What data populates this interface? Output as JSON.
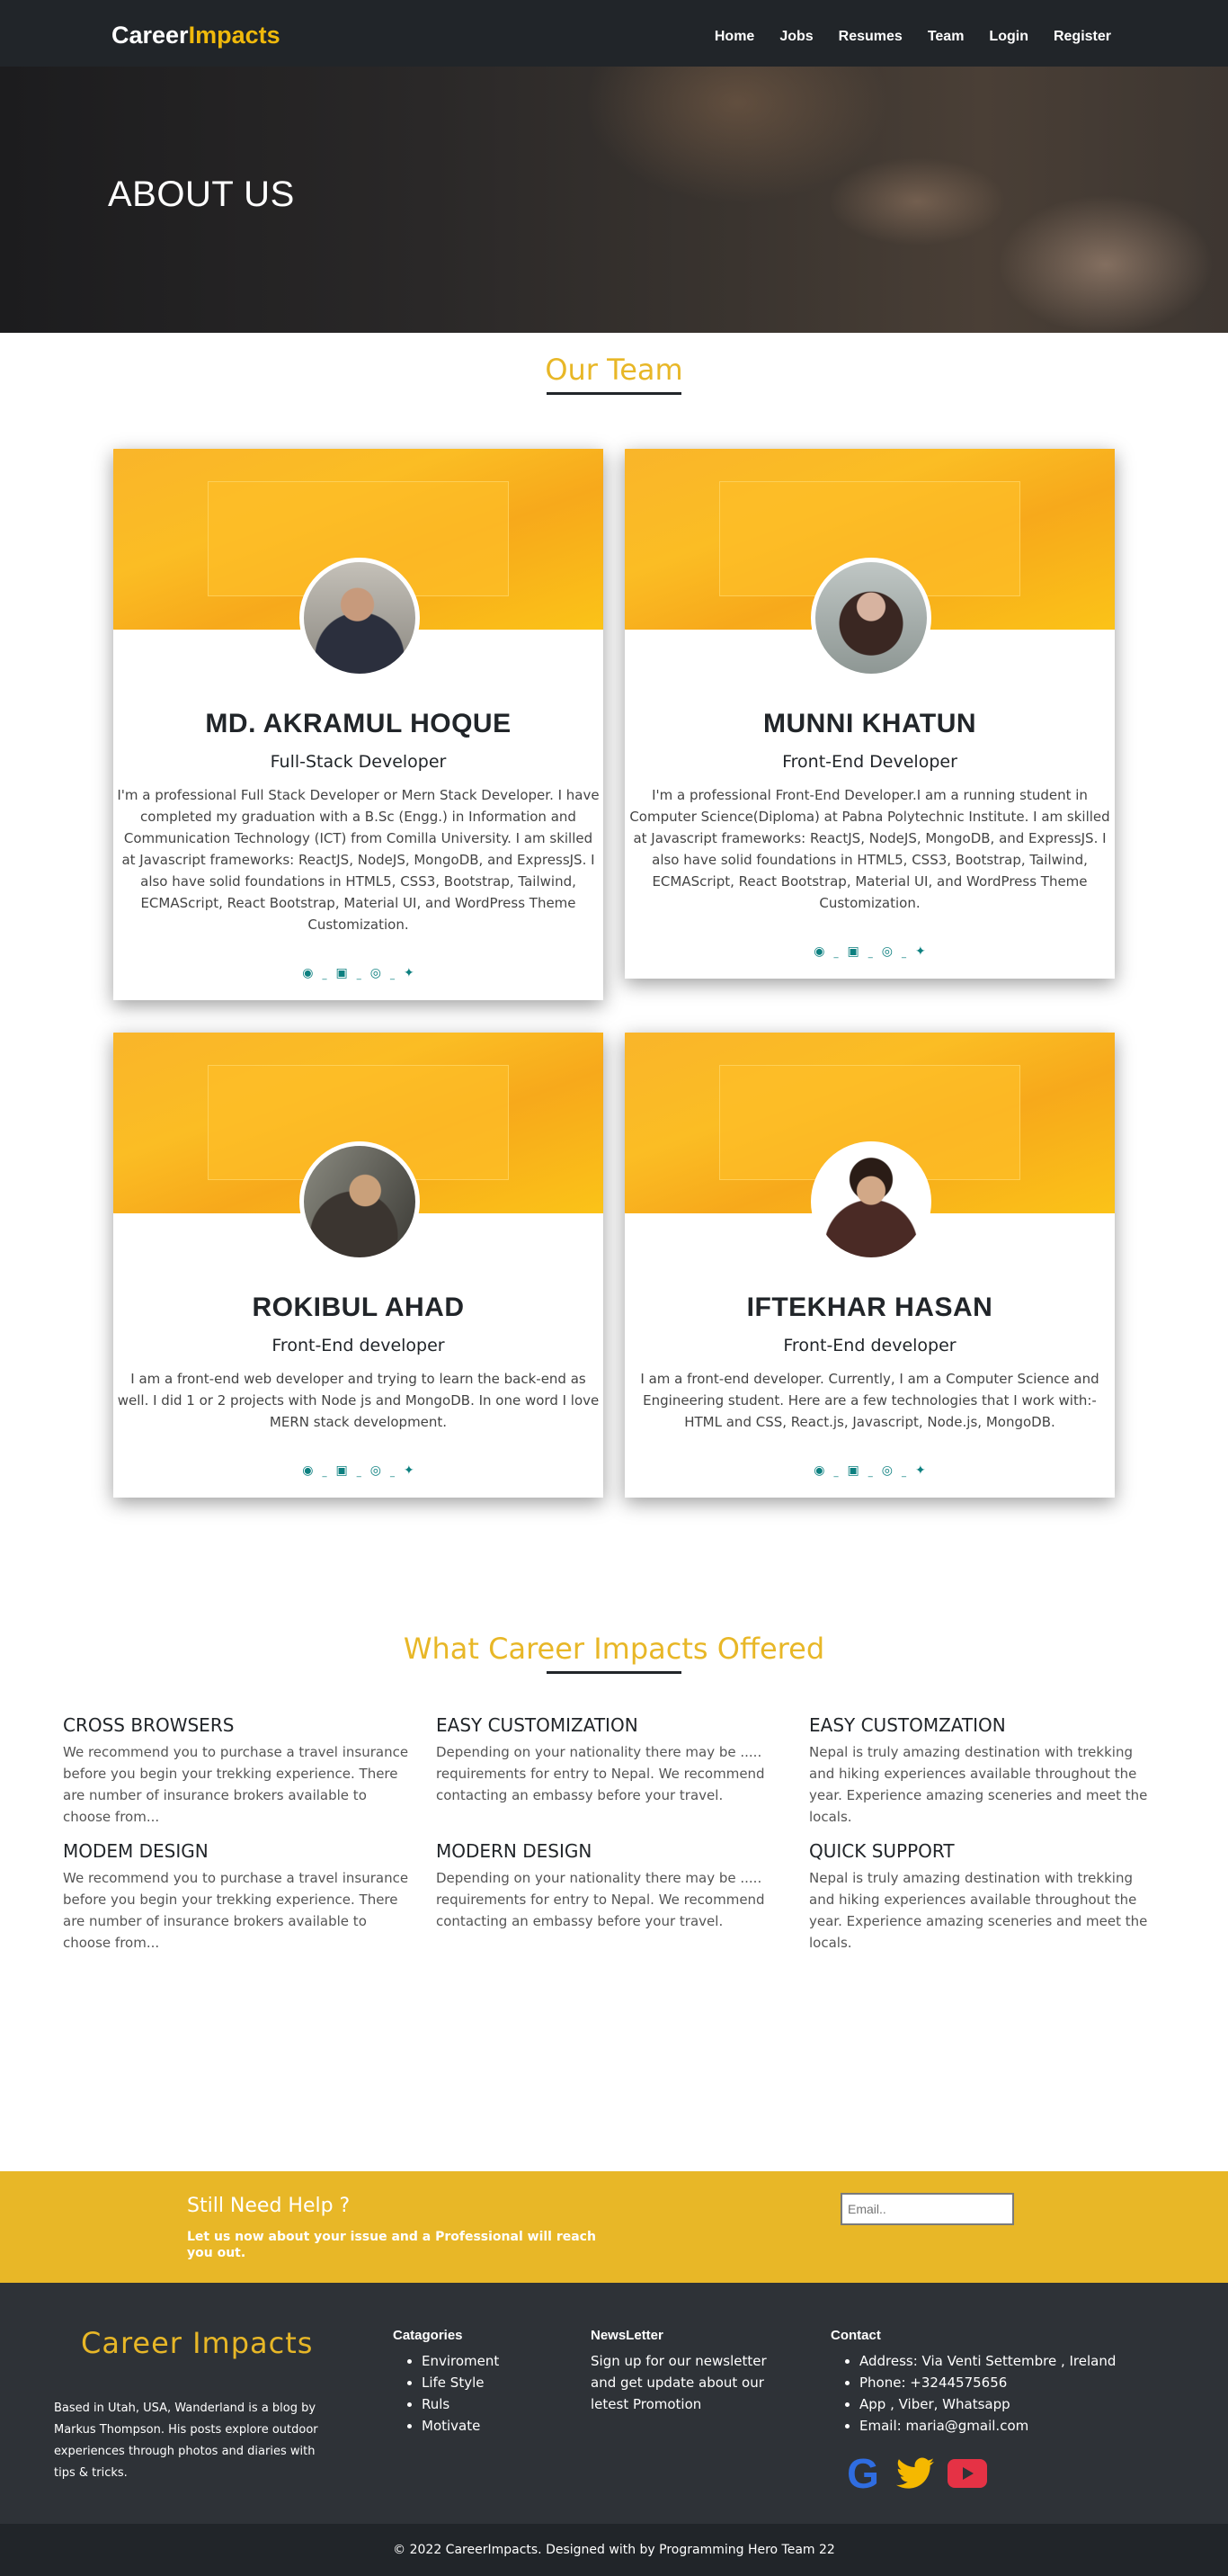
{
  "nav": {
    "brand_part1": "Career",
    "brand_part2": "Impacts",
    "links": [
      "Home",
      "Jobs",
      "Resumes",
      "Team",
      "Login",
      "Register"
    ]
  },
  "hero": {
    "title": "ABOUT US"
  },
  "team": {
    "heading": "Our Team",
    "members": [
      {
        "name": "MD. AKRAMUL HOQUE",
        "role": "Full-Stack Developer",
        "bio": "I'm a professional Full Stack Developer or Mern Stack Developer. I have completed my graduation with a B.Sc (Engg.) in Information and Communication Technology (ICT) from Comilla University. I am skilled at Javascript frameworks: ReactJS, NodeJS, MongoDB, and ExpressJS. I also have solid foundations in HTML5, CSS3, Bootstrap, Tailwind, ECMAScript, React Bootstrap, Material UI, and WordPress Theme Customization."
      },
      {
        "name": "MUNNI KHATUN",
        "role": "Front-End Developer",
        "bio": "I'm a professional Front-End Developer.I am a running student in Computer Science(Diploma) at Pabna Polytechnic Institute. I am skilled at Javascript frameworks: ReactJS, NodeJS, MongoDB, and ExpressJS. I also have solid foundations in HTML5, CSS3, Bootstrap, Tailwind, ECMAScript, React Bootstrap, Material UI, and WordPress Theme Customization."
      },
      {
        "name": "ROKIBUL AHAD",
        "role": "Front-End developer",
        "bio": "I am a front-end web developer and trying to learn the back-end as well. I did 1 or 2 projects with Node js and MongoDB. In one word I love MERN stack development."
      },
      {
        "name": "IFTEKHAR HASAN",
        "role": "Front-End developer",
        "bio": "I am a front-end developer. Currently, I am a Computer Science and Engineering student. Here are a few technologies that I work with:- HTML and CSS, React.js, Javascript, Node.js, MongoDB."
      }
    ],
    "social_icons": [
      "facebook-icon",
      "linkedin-icon",
      "instagram-icon",
      "twitter-icon"
    ]
  },
  "offered": {
    "heading": "What Career Impacts Offered",
    "features": [
      {
        "title": "CROSS BROWSERS",
        "text": "We recommend you to purchase a travel insurance before you begin your trekking experience. There are number of insurance brokers available to choose from..."
      },
      {
        "title": "EASY CUSTOMIZATION",
        "text": "Depending on your nationality there may be ..... requirements for entry to Nepal. We recommend contacting an embassy before your travel."
      },
      {
        "title": "EASY CUSTOMZATION",
        "text": "Nepal is truly amazing destination with trekking and hiking experiences available throughout the year. Experience amazing sceneries and meet the locals."
      },
      {
        "title": "MODEM DESIGN",
        "text": "We recommend you to purchase a travel insurance before you begin your trekking experience. There are number of insurance brokers available to choose from..."
      },
      {
        "title": "MODERN DESIGN",
        "text": "Depending on your nationality there may be ..... requirements for entry to Nepal. We recommend contacting an embassy before your travel."
      },
      {
        "title": "QUICK SUPPORT",
        "text": "Nepal is truly amazing destination with trekking and hiking experiences available throughout the year. Experience amazing sceneries and meet the locals."
      }
    ]
  },
  "help": {
    "title": "Still Need Help ?",
    "subtitle": "Let us now about your issue and a Professional will reach you out.",
    "email_placeholder": "Email.."
  },
  "footer": {
    "brand": "Career Impacts",
    "about": "Based in Utah, USA, Wanderland is a blog by Markus Thompson. His posts explore outdoor experiences through photos and diaries with tips & tricks.",
    "categories_title": "Catagories",
    "categories": [
      "Enviroment",
      "Life Style",
      "Ruls",
      "Motivate"
    ],
    "newsletter_title": "NewsLetter",
    "newsletter_text": "Sign up for our newsletter and get update about our letest Promotion",
    "contact_title": "Contact",
    "contact": [
      "Address: Via Venti Settembre , Ireland",
      "Phone: +3244575656",
      "App , Viber, Whatsapp",
      "Email: maria@gmail.com"
    ],
    "social_icons": [
      "google-icon",
      "twitter-icon",
      "youtube-icon"
    ]
  },
  "copyright": "© 2022 CareerImpacts. Designed with by Programming Hero Team 22",
  "colors": {
    "accent": "#e8b727",
    "dark": "#212529",
    "footer": "#2e3237",
    "social": "#0d8080"
  }
}
